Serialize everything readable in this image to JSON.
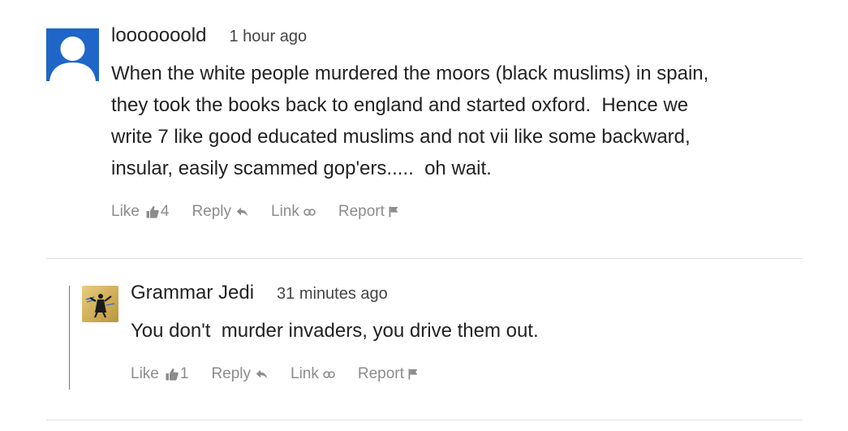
{
  "comments": [
    {
      "author": "looooooold",
      "time": "1 hour ago",
      "text": "When the white people murdered the moors (black muslims) in spain,\nthey took the books back to england and started oxford.  Hence we\nwrite 7 like good educated muslims and not vii like some backward,\ninsular, easily scammed gop'ers.....  oh wait.",
      "actions": {
        "like": "Like",
        "like_count": "4",
        "reply": "Reply",
        "link": "Link",
        "report": "Report"
      },
      "avatar_icon": "default-user-avatar"
    },
    {
      "author": "Grammar Jedi",
      "time": "31 minutes ago",
      "text": "You don't  murder invaders, you drive them out.",
      "actions": {
        "like": "Like",
        "like_count": "1",
        "reply": "Reply",
        "link": "Link",
        "report": "Report"
      },
      "avatar_icon": "user-avatar-image"
    }
  ],
  "colors": {
    "avatar_blue": "#1f66c8",
    "action_gray": "#8c8c8c",
    "divider": "#dedede"
  }
}
